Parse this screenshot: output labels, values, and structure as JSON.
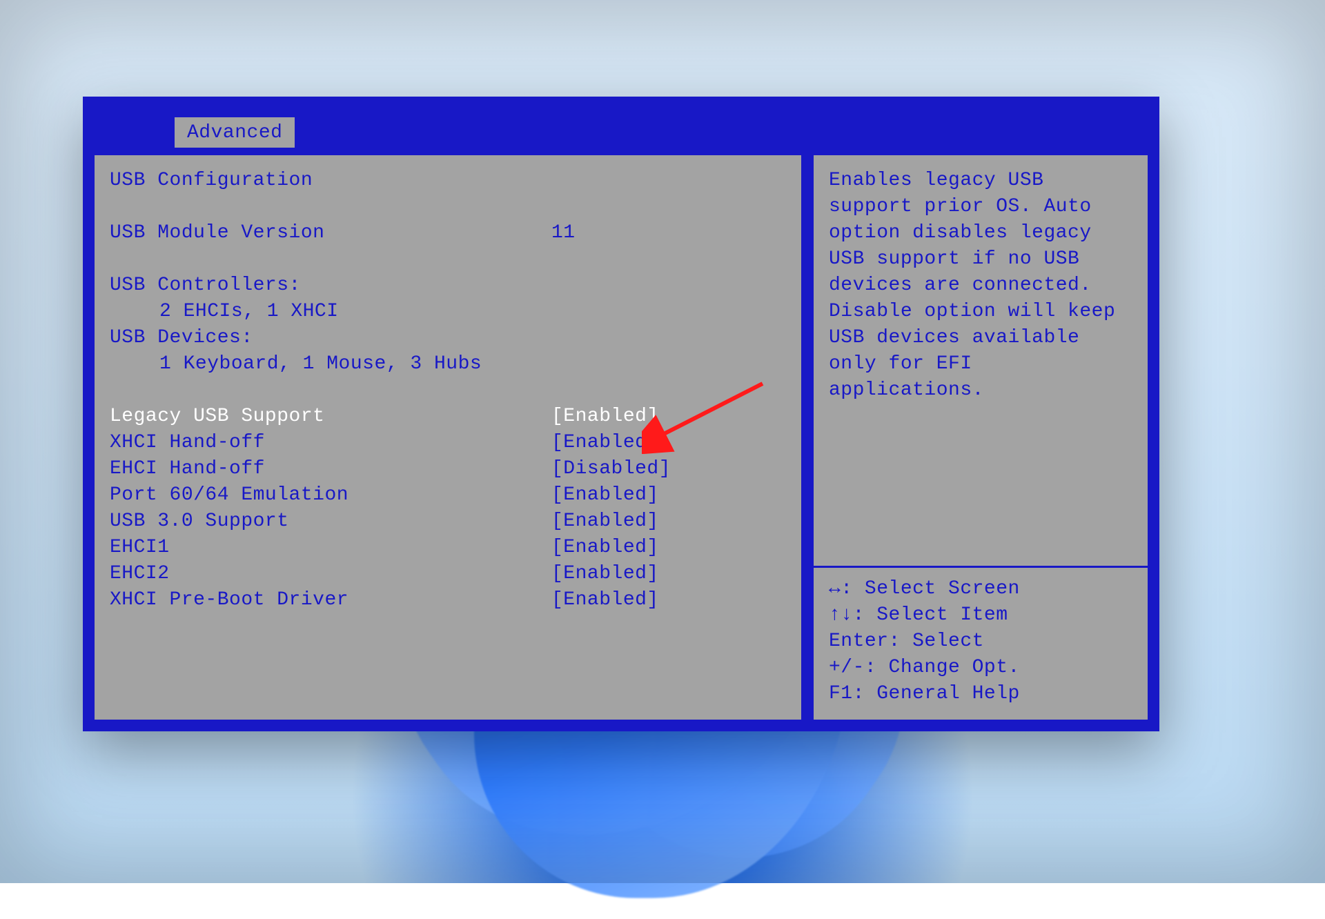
{
  "tab_label": "Advanced",
  "section_title": "USB Configuration",
  "info": {
    "module_version_label": "USB Module Version",
    "module_version_value": "11",
    "controllers_label": "USB Controllers:",
    "controllers_value": "2 EHCIs, 1 XHCI",
    "devices_label": "USB Devices:",
    "devices_value": "1 Keyboard, 1 Mouse, 3 Hubs"
  },
  "options": [
    {
      "label": "Legacy USB Support",
      "value": "[Enabled]",
      "selected": true
    },
    {
      "label": "XHCI Hand-off",
      "value": "[Enabled]",
      "selected": false
    },
    {
      "label": "EHCI Hand-off",
      "value": "[Disabled]",
      "selected": false
    },
    {
      "label": "Port 60/64 Emulation",
      "value": "[Enabled]",
      "selected": false
    },
    {
      "label": "USB 3.0 Support",
      "value": "[Enabled]",
      "selected": false
    },
    {
      "label": "EHCI1",
      "value": "[Enabled]",
      "selected": false
    },
    {
      "label": "EHCI2",
      "value": "[Enabled]",
      "selected": false
    },
    {
      "label": "XHCI Pre-Boot Driver",
      "value": "[Enabled]",
      "selected": false
    }
  ],
  "help_text": "Enables legacy USB support prior OS. Auto option disables legacy USB support if no USB devices are connected. Disable option will keep USB devices available only for EFI applications.",
  "legend": {
    "l1": "↔: Select Screen",
    "l2": "↑↓: Select Item",
    "l3": "Enter: Select",
    "l4": "+/-: Change Opt.",
    "l5": "F1: General Help"
  },
  "arrow_color": "#ff1a1a"
}
